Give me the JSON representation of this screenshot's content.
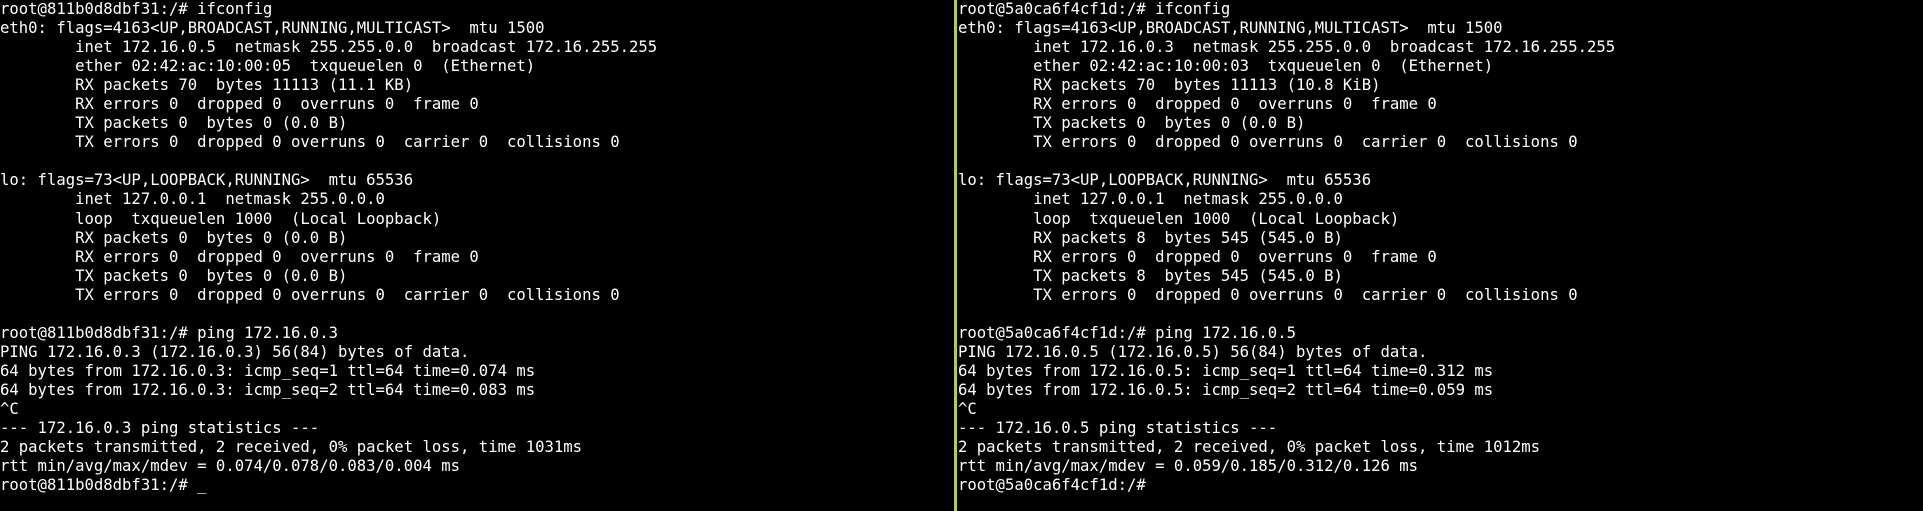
{
  "panes": {
    "left": {
      "lines": [
        "root@811b0d8dbf31:/# ifconfig",
        "eth0: flags=4163<UP,BROADCAST,RUNNING,MULTICAST>  mtu 1500",
        "        inet 172.16.0.5  netmask 255.255.0.0  broadcast 172.16.255.255",
        "        ether 02:42:ac:10:00:05  txqueuelen 0  (Ethernet)",
        "        RX packets 70  bytes 11113 (11.1 KB)",
        "        RX errors 0  dropped 0  overruns 0  frame 0",
        "        TX packets 0  bytes 0 (0.0 B)",
        "        TX errors 0  dropped 0 overruns 0  carrier 0  collisions 0",
        "",
        "lo: flags=73<UP,LOOPBACK,RUNNING>  mtu 65536",
        "        inet 127.0.0.1  netmask 255.0.0.0",
        "        loop  txqueuelen 1000  (Local Loopback)",
        "        RX packets 0  bytes 0 (0.0 B)",
        "        RX errors 0  dropped 0  overruns 0  frame 0",
        "        TX packets 0  bytes 0 (0.0 B)",
        "        TX errors 0  dropped 0 overruns 0  carrier 0  collisions 0",
        "",
        "root@811b0d8dbf31:/# ping 172.16.0.3",
        "PING 172.16.0.3 (172.16.0.3) 56(84) bytes of data.",
        "64 bytes from 172.16.0.3: icmp_seq=1 ttl=64 time=0.074 ms",
        "64 bytes from 172.16.0.3: icmp_seq=2 ttl=64 time=0.083 ms",
        "^C",
        "--- 172.16.0.3 ping statistics ---",
        "2 packets transmitted, 2 received, 0% packet loss, time 1031ms",
        "rtt min/avg/max/mdev = 0.074/0.078/0.083/0.004 ms"
      ],
      "prompt": "root@811b0d8dbf31:/# ",
      "cursor": "_"
    },
    "right": {
      "lines": [
        "root@5a0ca6f4cf1d:/# ifconfig",
        "eth0: flags=4163<UP,BROADCAST,RUNNING,MULTICAST>  mtu 1500",
        "        inet 172.16.0.3  netmask 255.255.0.0  broadcast 172.16.255.255",
        "        ether 02:42:ac:10:00:03  txqueuelen 0  (Ethernet)",
        "        RX packets 70  bytes 11113 (10.8 KiB)",
        "        RX errors 0  dropped 0  overruns 0  frame 0",
        "        TX packets 0  bytes 0 (0.0 B)",
        "        TX errors 0  dropped 0 overruns 0  carrier 0  collisions 0",
        "",
        "lo: flags=73<UP,LOOPBACK,RUNNING>  mtu 65536",
        "        inet 127.0.0.1  netmask 255.0.0.0",
        "        loop  txqueuelen 1000  (Local Loopback)",
        "        RX packets 8  bytes 545 (545.0 B)",
        "        RX errors 0  dropped 0  overruns 0  frame 0",
        "        TX packets 8  bytes 545 (545.0 B)",
        "        TX errors 0  dropped 0 overruns 0  carrier 0  collisions 0",
        "",
        "root@5a0ca6f4cf1d:/# ping 172.16.0.5",
        "PING 172.16.0.5 (172.16.0.5) 56(84) bytes of data.",
        "64 bytes from 172.16.0.5: icmp_seq=1 ttl=64 time=0.312 ms",
        "64 bytes from 172.16.0.5: icmp_seq=2 ttl=64 time=0.059 ms",
        "^C",
        "--- 172.16.0.5 ping statistics ---",
        "2 packets transmitted, 2 received, 0% packet loss, time 1012ms",
        "rtt min/avg/max/mdev = 0.059/0.185/0.312/0.126 ms"
      ],
      "prompt": "root@5a0ca6f4cf1d:/#",
      "cursor": ""
    }
  },
  "colors": {
    "background": "#000000",
    "text": "#ffffff",
    "divider": "#b5c95a"
  }
}
